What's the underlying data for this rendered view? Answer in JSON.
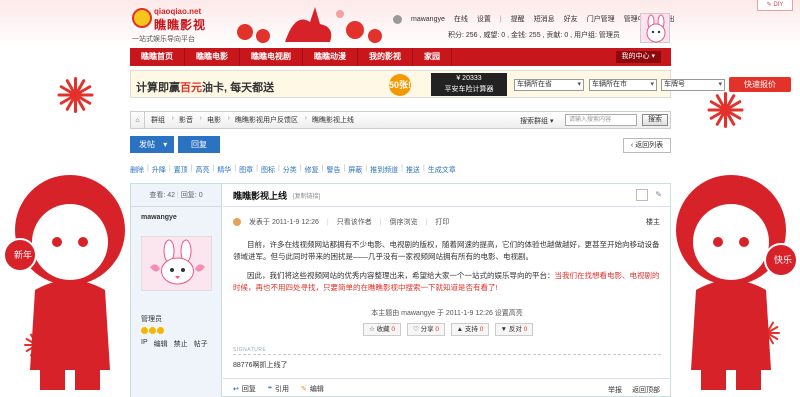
{
  "header": {
    "logo": {
      "domain": "qiaoqiao.net",
      "brand": "瞧瞧影视",
      "tagline": "一站式娱乐导向平台"
    },
    "username": "mawangye",
    "online": "在线",
    "links": [
      "设置",
      "提醒",
      "短消息",
      "好友",
      "门户管理",
      "管理中心",
      "退出"
    ],
    "stats": "积分: 256 , 威望: 0 , 金钱: 255 , 贡献: 0 , 用户组: 管理员",
    "diy": "DIY"
  },
  "nav": {
    "items": [
      "瞧瞧首页",
      "瞧瞧电影",
      "瞧瞧电视剧",
      "瞧瞧动漫",
      "我的影视",
      "家园"
    ],
    "my_center": "我的中心"
  },
  "ad": {
    "text_pre": "计算即赢",
    "text_em": "百元",
    "text_post": "油卡, 每天都送",
    "badge": "50张!",
    "calc_line1": "¥ 20333",
    "calc_line2": "平安车险计算器",
    "select1": "车辆所在省",
    "select2": "车辆所在市",
    "select3": "车牌号",
    "button": "快速报价"
  },
  "breadcrumb": {
    "items": [
      "群组",
      "影音",
      "电影",
      "瞧瞧影视用户反馈区",
      "瞧瞧影视上线"
    ],
    "search_label": "搜索群组",
    "search_placeholder": "请输入搜索内容",
    "search_button": "搜索"
  },
  "actions": {
    "post": "发帖",
    "reply": "回复",
    "back": "返回列表"
  },
  "mod_tools": [
    "删除",
    "升降",
    "置顶",
    "高亮",
    "精华",
    "图章",
    "图标",
    "分类",
    "修复",
    "警告",
    "屏蔽",
    "推到频道",
    "推送",
    "生成文章"
  ],
  "post": {
    "views": "查看: 42",
    "replies": "回复: 0",
    "author": "mawangye",
    "role": "管理员",
    "author_ops": [
      "IP",
      "编辑",
      "禁止",
      "帖子"
    ],
    "title": "瞧瞧影视上线",
    "copy_link": "[复制链接]",
    "meta_posted": "发表于 2011-1-9 12:26",
    "meta_only_author": "只看该作者",
    "meta_reverse": "倒序浏览",
    "meta_print": "打印",
    "floor": "楼主",
    "para1": "目前，许多在线视频网站都拥有不少电影、电视剧的版权，随着网速的提高，它们的体验也越做越好，更甚至开始向移动设备领域进军。但与此同时带来的困扰是——几乎没有一家视频网站拥有所有的电影、电视剧。",
    "para2_a": "因此，我们将这些视频网站的优秀内容整理出来，希望给大家一个一站式的娱乐导向的平台：",
    "para2_b": "当我们在找想看电影、电视剧的时候，再也不用四处寻找，只要简单的在瞧瞧影视中搜索一下就知道是否有看了!",
    "edit_note": "本主题由 mawangye 于 2011-1-9 12:26 设置高亮",
    "reactions": [
      {
        "label": "收藏",
        "count": "0"
      },
      {
        "label": "分享",
        "count": "0"
      },
      {
        "label": "支持",
        "count": "0"
      },
      {
        "label": "反对",
        "count": "0"
      }
    ],
    "signature_label": "SIGNATURE",
    "signature": "88776啊抓上线了",
    "footer_reply": "回复",
    "footer_quote": "引用",
    "footer_edit": "编辑",
    "footer_report": "举报",
    "footer_top": "返回顶部"
  }
}
